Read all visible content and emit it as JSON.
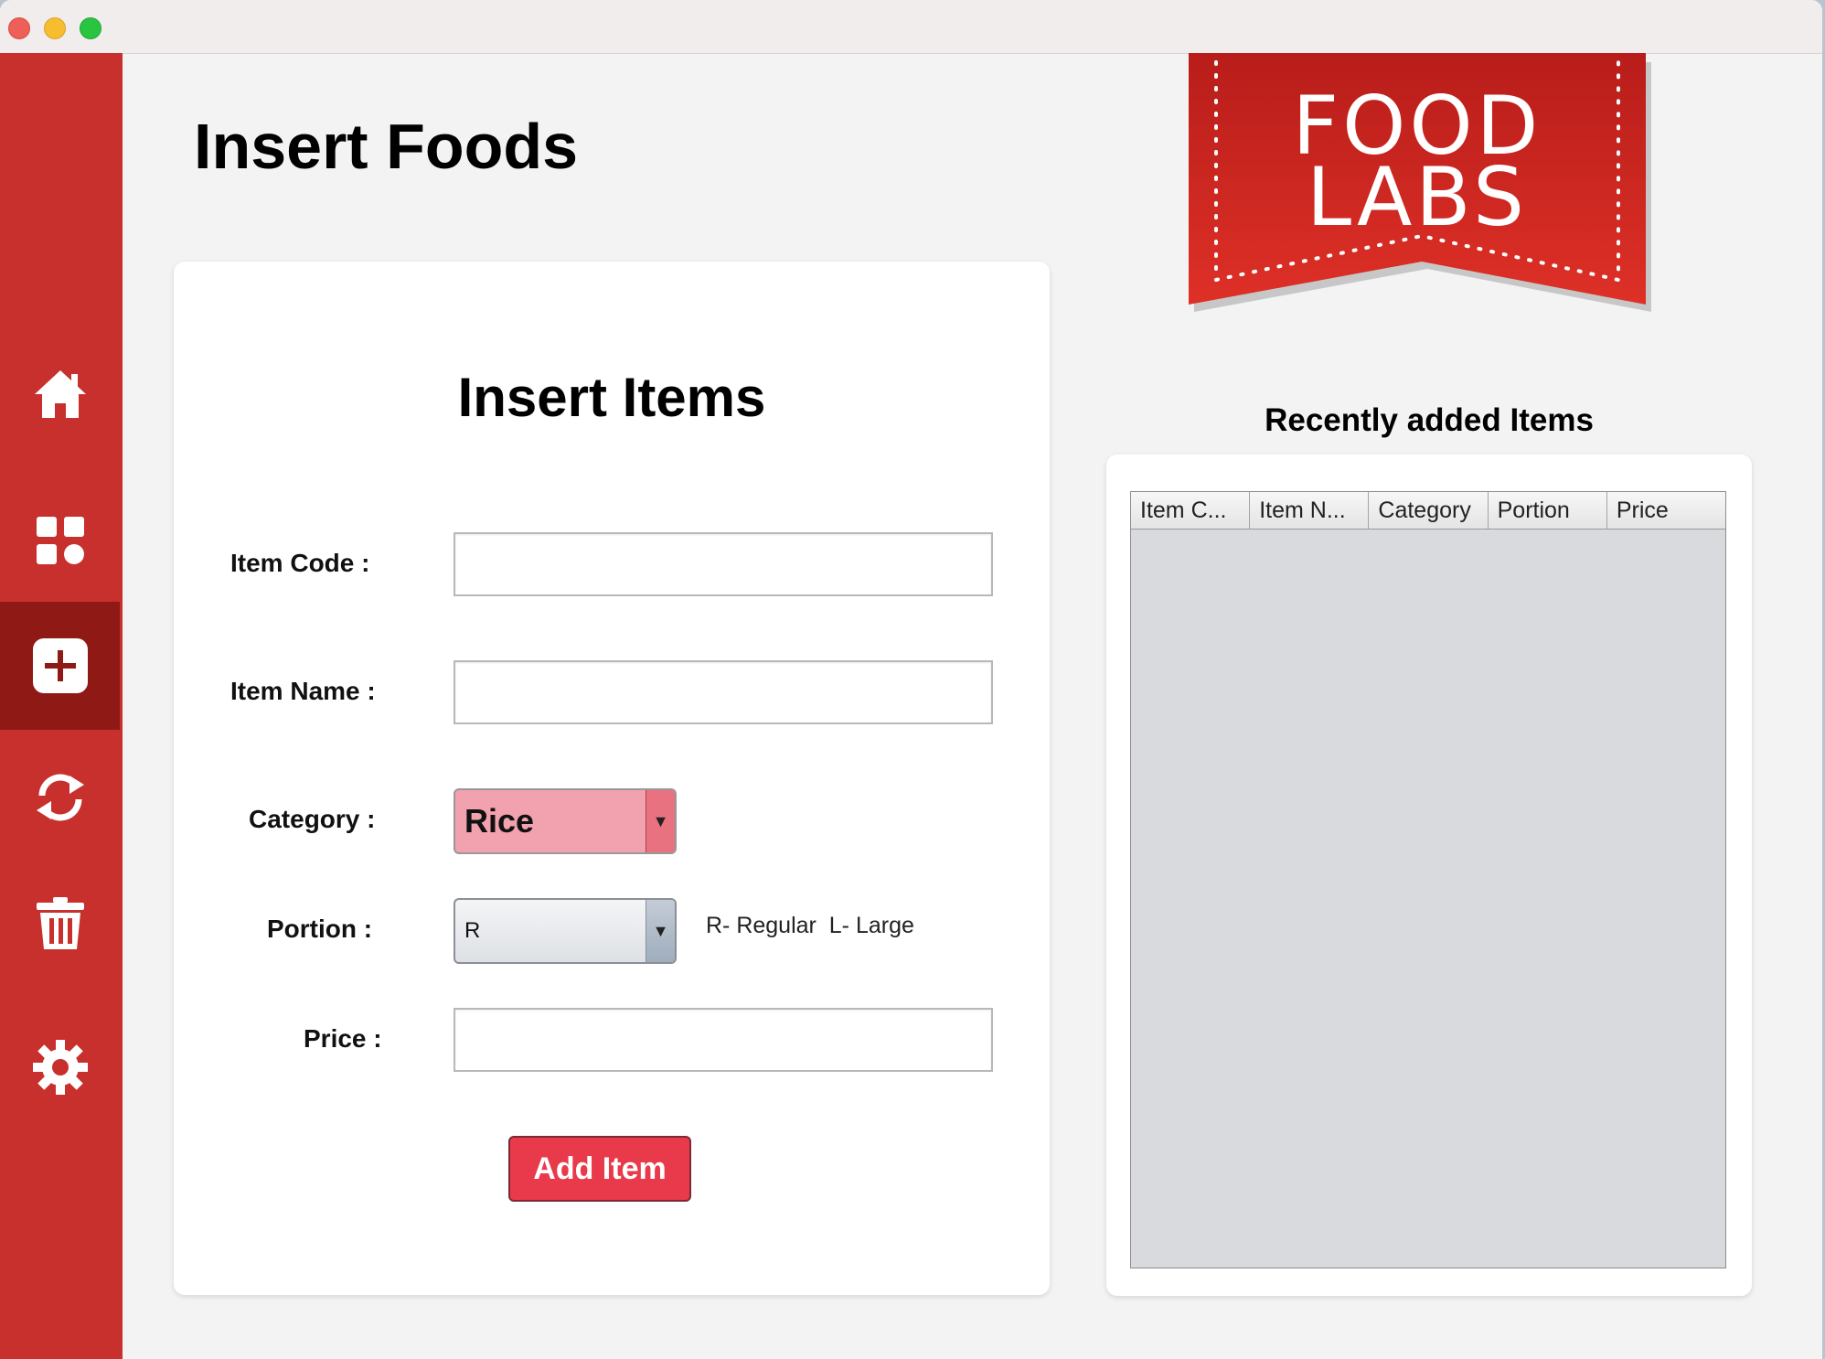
{
  "window": {
    "title_controls": [
      "close",
      "minimize",
      "maximize"
    ]
  },
  "sidebar": {
    "background_color": "#c7302d",
    "active_color": "#8f1a15",
    "items": [
      {
        "icon": "home-icon"
      },
      {
        "icon": "dashboard-icon"
      },
      {
        "icon": "add-icon",
        "active": true
      },
      {
        "icon": "refresh-icon"
      },
      {
        "icon": "trash-icon"
      },
      {
        "icon": "gear-icon"
      }
    ]
  },
  "page": {
    "title": "Insert Foods"
  },
  "logo": {
    "line1": "FOOD",
    "line2": "LABS",
    "color": "#d42a25"
  },
  "form": {
    "title": "Insert Items",
    "item_code_label": "Item Code :",
    "item_name_label": "Item Name :",
    "category_label": "Category :",
    "category_value": "Rice",
    "portion_label": "Portion :",
    "portion_value": "R",
    "portion_hint": "R- Regular  L- Large",
    "price_label": "Price :",
    "add_button": "Add Item",
    "accent_color": "#e93a4c"
  },
  "recent": {
    "title": "Recently added Items",
    "columns": [
      "Item C...",
      "Item N...",
      "Category",
      "Portion",
      "Price"
    ],
    "rows": []
  }
}
